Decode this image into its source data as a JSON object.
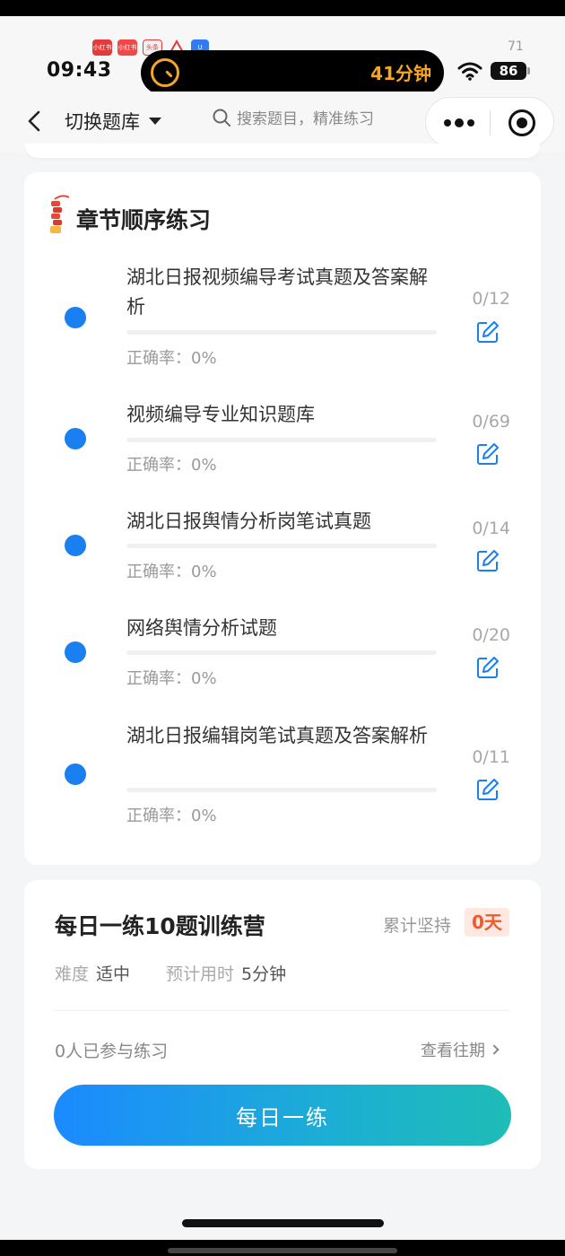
{
  "status_bar": {
    "time": "09:43",
    "island_timer": "41分钟",
    "battery": "86",
    "top_right_number": "71",
    "mini_icons": [
      "app-icon-red",
      "app-icon-red",
      "toutiao-icon",
      "warning-icon",
      "shield-app-icon"
    ],
    "mini_icon_labels": [
      "小红书",
      "小红书",
      "头条"
    ]
  },
  "nav": {
    "switch_label": "切换题库",
    "search_placeholder": "搜索题目，精准练习"
  },
  "chapter": {
    "title": "章节顺序练习",
    "items": [
      {
        "title": "湖北日报视频编导考试真题及答案解析",
        "rate": "正确率：0%",
        "count": "0/12",
        "progress": 0
      },
      {
        "title": "视频编导专业知识题库",
        "rate": "正确率：0%",
        "count": "0/69",
        "progress": 0
      },
      {
        "title": "湖北日报舆情分析岗笔试真题",
        "rate": "正确率：0%",
        "count": "0/14",
        "progress": 0
      },
      {
        "title": "网络舆情分析试题",
        "rate": "正确率：0%",
        "count": "0/20",
        "progress": 0
      },
      {
        "title": "湖北日报编辑岗笔试真题及答案解析",
        "rate": "正确率：0%",
        "count": "0/11",
        "progress": 0
      }
    ]
  },
  "daily": {
    "title": "每日一练10题训练营",
    "persist_label": "累计坚持",
    "persist_value": "0天",
    "difficulty_label": "难度",
    "difficulty_value": "适中",
    "time_label": "预计用时",
    "time_value": "5分钟",
    "participants": "0人已参与练习",
    "history_link": "查看往期",
    "button_label": "每日一练"
  },
  "colors": {
    "accent_blue": "#1a7ff0",
    "island_orange": "#f5a623",
    "persist_red": "#f05a2b",
    "button_gradient_start": "#1b8aff",
    "button_gradient_end": "#1fbcb7"
  }
}
